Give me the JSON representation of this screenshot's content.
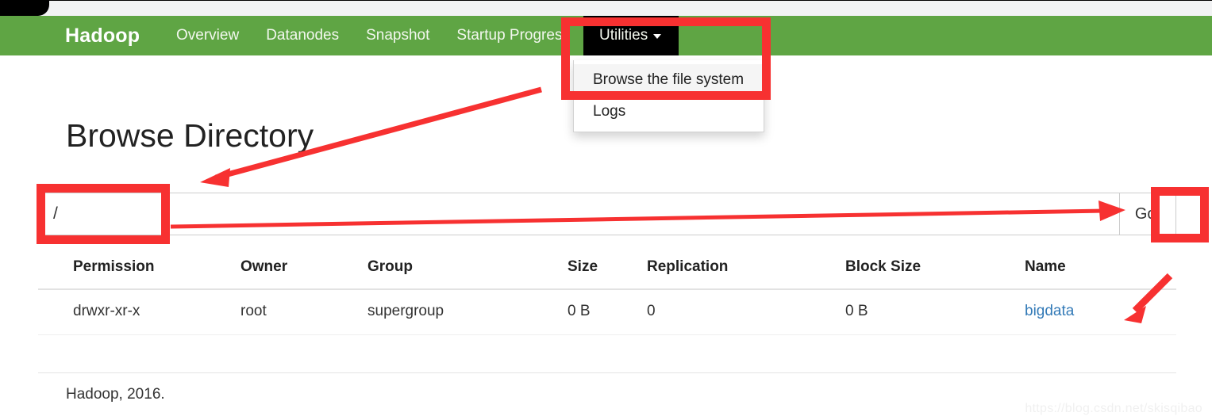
{
  "browser": {
    "tab_strip": "browser-tab-strip"
  },
  "navbar": {
    "brand": "Hadoop",
    "items": [
      {
        "label": "Overview"
      },
      {
        "label": "Datanodes"
      },
      {
        "label": "Snapshot"
      },
      {
        "label": "Startup Progress"
      }
    ],
    "dropdown": {
      "label": "Utilities",
      "caret": "caret-down-icon",
      "items": [
        {
          "label": "Browse the file system",
          "highlighted": true
        },
        {
          "label": "Logs",
          "highlighted": false
        }
      ]
    }
  },
  "main": {
    "title": "Browse Directory",
    "path": {
      "value": "/",
      "placeholder": "",
      "go_label": "Go!"
    },
    "table": {
      "headers": [
        "Permission",
        "Owner",
        "Group",
        "Size",
        "Replication",
        "Block Size",
        "Name"
      ],
      "rows": [
        {
          "permission": "drwxr-xr-x",
          "owner": "root",
          "group": "supergroup",
          "size": "0 B",
          "replication": "0",
          "block_size": "0 B",
          "name": "bigdata"
        }
      ]
    }
  },
  "footer": {
    "text": "Hadoop, 2016.",
    "watermark": "https://blog.csdn.net/skisqibao"
  },
  "annotations": {
    "highlight_color": "#f73131",
    "boxes": [
      {
        "name": "utilities-menu-highlight"
      },
      {
        "name": "path-input-highlight"
      },
      {
        "name": "go-button-highlight"
      }
    ],
    "arrows": [
      {
        "name": "arrow-to-path-input"
      },
      {
        "name": "arrow-to-go-button"
      },
      {
        "name": "arrow-to-bigdata-link"
      }
    ]
  },
  "colors": {
    "navbar_green": "#5fa544",
    "utilities_active": "#000000",
    "link_blue": "#337ab7"
  }
}
